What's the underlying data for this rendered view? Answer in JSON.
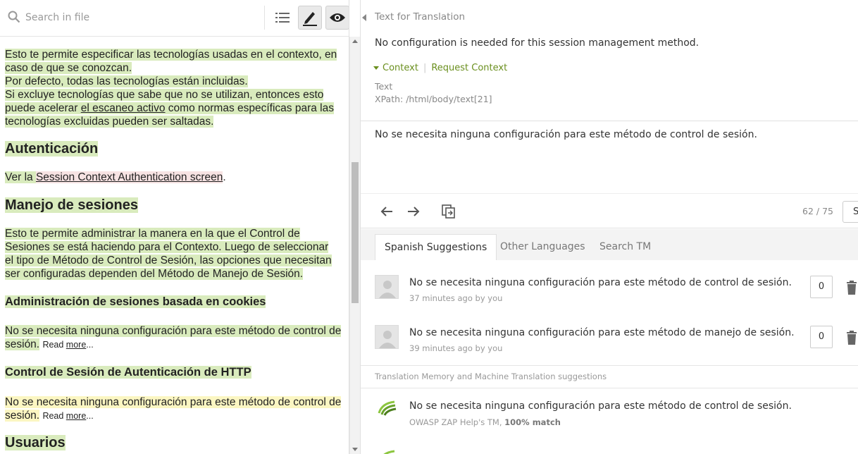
{
  "left_toolbar": {
    "search_placeholder": "Search in file",
    "icons": [
      "search-icon",
      "list-icon",
      "pencil-icon",
      "eye-icon"
    ]
  },
  "left_content": {
    "para1_line1": "Esto te permite especificar las tecnologías usadas en el contexto, en",
    "para1_line2": "caso de que se conozcan.",
    "para1_line3": "Por defecto, todas las tecnologías están incluidas.",
    "para1_line4": "Si excluye tecnologías que sabe que no se utilizan, entonces esto",
    "para1_line5a": "puede acelerar ",
    "para1_link": "el escaneo activo",
    "para1_line5b": " como normas específicas para las",
    "para1_line6": "tecnologías excluidas pueden ser saltadas.",
    "h_auth": "Autenticación",
    "auth_pre": "Ver la ",
    "auth_link": "Session Context Authentication screen",
    "auth_post": ".",
    "h_sessions": "Manejo de sesiones",
    "sess_line1": "Esto te permite administrar la manera en la que el Control de",
    "sess_line2": "Sesiones se está haciendo para el Contexto. Luego de seleccionar",
    "sess_line3": "el tipo de Método de Control de Sesión, las opciones que necesitan",
    "sess_line4": "ser configuradas dependen del Método de Manejo de Sesión.",
    "h_cookies": "Administración de sesiones basada en cookies",
    "cookie_line1": "No se necesita ninguna configuración para este método de control de",
    "cookie_line2": "sesión.",
    "read_more_1": "Read ",
    "read_more_2": "more",
    "read_more_3": "...",
    "h_http": "Control de Sesión de Autenticación de HTTP",
    "http_line1": "No se necesita ninguna configuración para este método de control de",
    "http_line2": "sesión.",
    "h_users": "Usuarios"
  },
  "source": {
    "label": "Text for Translation",
    "text": "No configuration is needed for this session management method.",
    "context_link": "Context",
    "request_context_link": "Request Context",
    "context_type": "Text",
    "xpath": "XPath: /html/body/text[21]"
  },
  "translation": {
    "text": "No se necesita ninguna configuración para este método de control de sesión."
  },
  "editor": {
    "progress": "62 / 75",
    "save_label": "S"
  },
  "tabs": {
    "spanish": "Spanish Suggestions",
    "other": "Other Languages",
    "search_tm": "Search TM"
  },
  "suggestions": [
    {
      "text": "No se necesita ninguna configuración para este método de control de sesión.",
      "meta": "37 minutes ago by you",
      "votes": "0"
    },
    {
      "text": "No se necesita ninguna configuración para este método de manejo de sesión.",
      "meta": "39 minutes ago by you",
      "votes": "0"
    }
  ],
  "tm": {
    "header": "Translation Memory and Machine Translation suggestions",
    "items": [
      {
        "text": "No se necesita ninguna configuración para este método de control de sesión.",
        "source": "OWASP ZAP Help's TM, ",
        "match": "100% match"
      }
    ]
  },
  "colors": {
    "accent_green": "#6a8f1e",
    "highlight_green": "#d9ebbd",
    "highlight_yellow": "#fbf6c2"
  }
}
